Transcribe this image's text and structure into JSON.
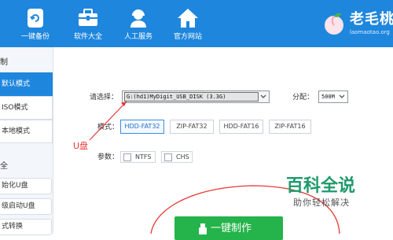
{
  "nav": {
    "items": [
      {
        "label": "一键备份",
        "icon": "refresh-icon"
      },
      {
        "label": "软件大全",
        "icon": "toolbox-icon"
      },
      {
        "label": "人工服务",
        "icon": "support-agent-icon"
      },
      {
        "label": "官方网站",
        "icon": "home-icon"
      }
    ],
    "brand": {
      "name": "老毛桃",
      "url": "laomaotao.org"
    }
  },
  "sidebar": {
    "section_top": "制",
    "modes": [
      {
        "label": "默认模式",
        "active": true
      },
      {
        "label": "ISO模式",
        "active": false
      },
      {
        "label": "本地模式",
        "active": false
      }
    ],
    "section_bottom": "全",
    "tools": [
      {
        "label": "始化U盘"
      },
      {
        "label": "级启动U盘"
      },
      {
        "label": "式转换"
      }
    ]
  },
  "form": {
    "device_label": "请选择：",
    "device_value": "G:(hd1)MyDigit_USB_DISK (3.3G)",
    "alloc_label": "分配：",
    "alloc_value": "500M",
    "mode_label": "模式：",
    "modes": [
      {
        "label": "HDD-FAT32",
        "selected": true
      },
      {
        "label": "ZIP-FAT32",
        "selected": false
      },
      {
        "label": "HDD-FAT16",
        "selected": false
      },
      {
        "label": "ZIP-FAT16",
        "selected": false
      }
    ],
    "params_label": "参数：",
    "params": [
      {
        "label": "NTFS",
        "checked": false
      },
      {
        "label": "CHS",
        "checked": false
      }
    ],
    "make_button": "一键制作"
  },
  "annotation": {
    "text": "U盘"
  },
  "watermark": {
    "title": "百科全说",
    "subtitle": "助你轻松解决"
  },
  "colors": {
    "header": "#1e86dd",
    "accent": "#1e86dd",
    "make_button": "#25b34b",
    "annotation": "#e53935",
    "watermark": "#1f9a6b"
  }
}
